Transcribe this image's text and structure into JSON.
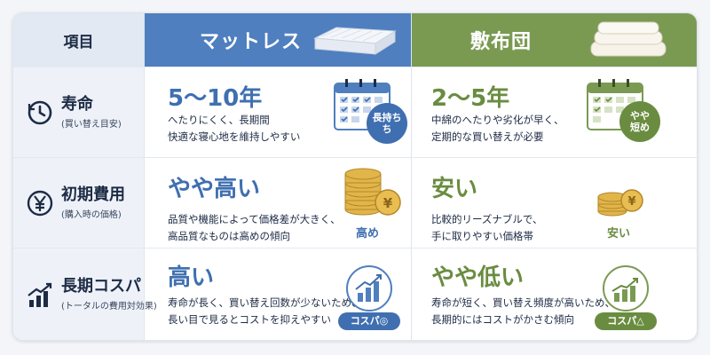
{
  "header": {
    "item_label": "項目",
    "mattress_label": "マットレス",
    "futon_label": "敷布団"
  },
  "rows": [
    {
      "label": "寿命",
      "sub": "(買い替え目安)",
      "mattress": {
        "value": "5〜10年",
        "desc1": "へたりにくく、長期間",
        "desc2": "快適な寝心地を維持しやすい",
        "badge1": "長持ち",
        "badge2": "ち"
      },
      "futon": {
        "value": "2〜5年",
        "desc1": "中綿のへたりや劣化が早く、",
        "desc2": "定期的な買い替えが必要",
        "badge1": "やや",
        "badge2": "短め"
      }
    },
    {
      "label": "初期費用",
      "sub": "(購入時の価格)",
      "mattress": {
        "value": "やや高い",
        "desc1": "品質や機能によって価格差が大きく、",
        "desc2": "高品質なものは高めの傾向",
        "badge": "高め"
      },
      "futon": {
        "value": "安い",
        "desc1": "比較的リーズナブルで、",
        "desc2": "手に取りやすい価格帯",
        "badge": "安い"
      }
    },
    {
      "label": "長期コスパ",
      "sub": "(トータルの費用対効果)",
      "mattress": {
        "value": "高い",
        "desc1": "寿命が長く、買い替え回数が少ないため、",
        "desc2": "長い目で見るとコストを抑えやすい",
        "badge": "コスパ◎"
      },
      "futon": {
        "value": "やや低い",
        "desc1": "寿命が短く、買い替え頻度が高いため、",
        "desc2": "長期的にはコストがかさむ傾向",
        "badge": "コスパ△"
      }
    }
  ],
  "colors": {
    "blue": "#4f7fbf",
    "green": "#7a9a52",
    "navy": "#1d2b45",
    "gold": "#d9a93a"
  },
  "icons": [
    "clock-icon",
    "yen-icon",
    "chart-up-icon",
    "mattress-icon",
    "futon-icon",
    "calendar-icon",
    "coin-stack-icon",
    "cost-chart-icon"
  ]
}
